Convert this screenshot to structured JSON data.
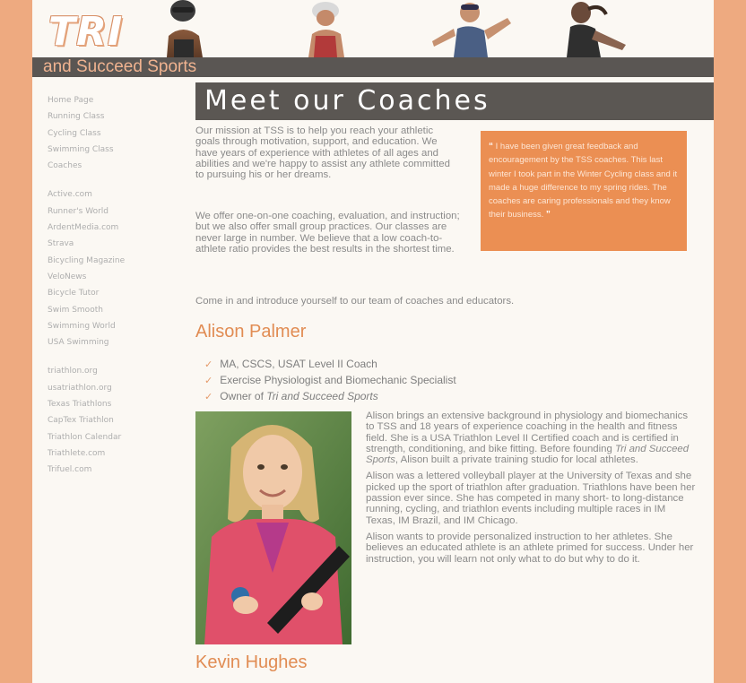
{
  "header": {
    "logo": "TRI",
    "tagline": "and Succeed Sports"
  },
  "sidebar": {
    "groups": [
      [
        "Home Page",
        "Running Class",
        "Cycling Class",
        "Swimming Class",
        "Coaches"
      ],
      [
        "Active.com",
        "Runner's World",
        "ArdentMedia.com",
        "Strava",
        "Bicycling Magazine",
        "VeloNews",
        "Bicycle Tutor",
        "Swim Smooth",
        "Swimming World",
        "USA Swimming"
      ],
      [
        "triathlon.org",
        "usatriathlon.org",
        "Texas Triathlons",
        "CapTex Triathlon",
        "Triathlon Calendar",
        "Triathlete.com",
        "Trifuel.com"
      ]
    ]
  },
  "main": {
    "title": "Meet our Coaches",
    "intro1": "Our mission at TSS is to help you reach your athletic goals through motivation, support, and education. We have years of experience with athletes of all ages and abilities and we're happy to assist any athlete committed to pursuing his or her dreams.",
    "intro2": "We offer one-on-one coaching, evaluation, and instruction; but we also offer small group practices. Our classes are never large in number. We believe that a low coach-to-athlete ratio provides the best results in the shortest time.",
    "intro3": "Come in and introduce yourself to our team of coaches and educators.",
    "quote_open": "“",
    "quote": "I have been given great feedback and encouragement by the TSS coaches. This last winter I took part in the Winter Cycling class and it made a huge difference to my spring rides. The coaches are caring professionals and they know their business.",
    "quote_close": "”",
    "coaches": [
      {
        "name": "Alison Palmer",
        "credentials": [
          "MA, CSCS, USAT Level II Coach",
          "Exercise Physiologist and Biomechanic Specialist",
          "Owner of "
        ],
        "credential_italic": "Tri and Succeed Sports",
        "bio": [
          "Alison brings an extensive background in physiology and biomechanics to TSS and 18 years of experience coaching in the health and fitness field. She is a USA Triathlon Level II Certified coach and is certified in strength, conditioning, and bike fitting. Before founding ",
          "Tri and Succeed Sports",
          ", Alison built a private training studio for local athletes.",
          "Alison was a lettered volleyball player at the University of Texas and she picked up the sport of triathlon after graduation. Triathlons have been her passion ever since. She has competed in many short- to long-distance running, cycling, and triathlon events including multiple races in IM Texas, IM Brazil, and IM Chicago.",
          "Alison wants to provide personalized instruction to her athletes. She believes an educated athlete is an athlete primed for success. Under her instruction, you will learn not only what to do but why to do it."
        ]
      },
      {
        "name": "Kevin Hughes"
      }
    ]
  },
  "colors": {
    "accent": "#eb8f53",
    "bar": "#5b5753",
    "border": "#eeaa80"
  },
  "icons": {
    "check": "✓"
  }
}
